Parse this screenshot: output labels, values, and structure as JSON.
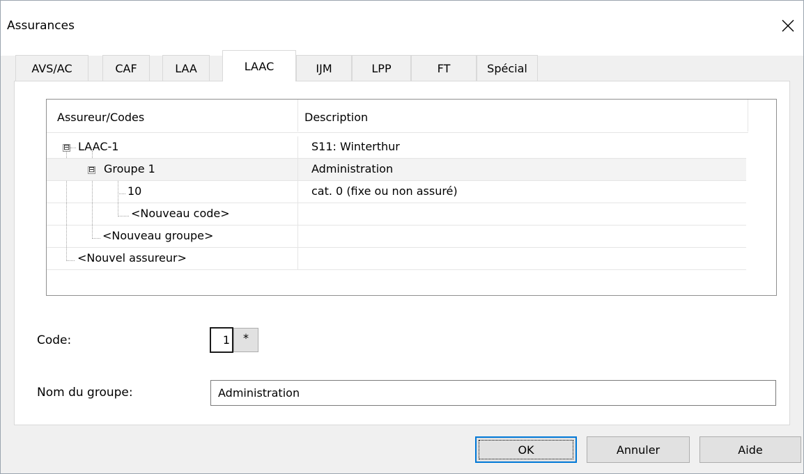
{
  "window": {
    "title": "Assurances",
    "close_icon": "close-icon"
  },
  "tabs": [
    {
      "label": "AVS/AC"
    },
    {
      "label": "CAF"
    },
    {
      "label": "LAA"
    },
    {
      "label": "LAAC"
    },
    {
      "label": "IJM"
    },
    {
      "label": "LPP"
    },
    {
      "label": "FT"
    },
    {
      "label": "Spécial"
    }
  ],
  "active_tab": "LAAC",
  "tree": {
    "columns": [
      "Assureur/Codes",
      "Description"
    ],
    "rows": [
      {
        "label": "LAAC-1",
        "description": "S11: Winterthur",
        "expand": "⊟"
      },
      {
        "label": "Groupe 1",
        "description": "Administration",
        "expand": "⊟",
        "selected": true
      },
      {
        "label": "10",
        "description": "cat. 0 (fixe ou non assuré)"
      },
      {
        "label": "<Nouveau code>",
        "description": ""
      },
      {
        "label": "<Nouveau groupe>",
        "description": ""
      },
      {
        "label": "<Nouvel assureur>",
        "description": ""
      }
    ]
  },
  "form": {
    "code_label": "Code:",
    "code_value": "1",
    "code_button": "*",
    "group_name_label": "Nom du groupe:",
    "group_name_value": "Administration"
  },
  "buttons": {
    "ok": "OK",
    "cancel": "Annuler",
    "help": "Aide"
  },
  "colors": {
    "focus_border": "#0078d7",
    "selected_row": "#f3f3f3"
  }
}
